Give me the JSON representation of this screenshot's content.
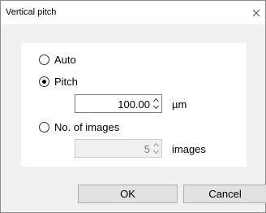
{
  "window": {
    "title": "Vertical pitch"
  },
  "options": {
    "auto_label": "Auto",
    "pitch_label": "Pitch",
    "images_label": "No. of images",
    "selected": "pitch"
  },
  "pitch": {
    "value": "100.00",
    "unit": "µm"
  },
  "images": {
    "value": "5",
    "unit": "images",
    "enabled": false
  },
  "buttons": {
    "ok": "OK",
    "cancel": "Cancel"
  },
  "icons": {
    "close": "close-icon",
    "spin_up": "chevron-up-icon",
    "spin_down": "chevron-down-icon"
  },
  "colors": {
    "window_bg": "#f0f0f0",
    "panel_bg": "#ffffff",
    "button_bg": "#e1e1e1"
  }
}
